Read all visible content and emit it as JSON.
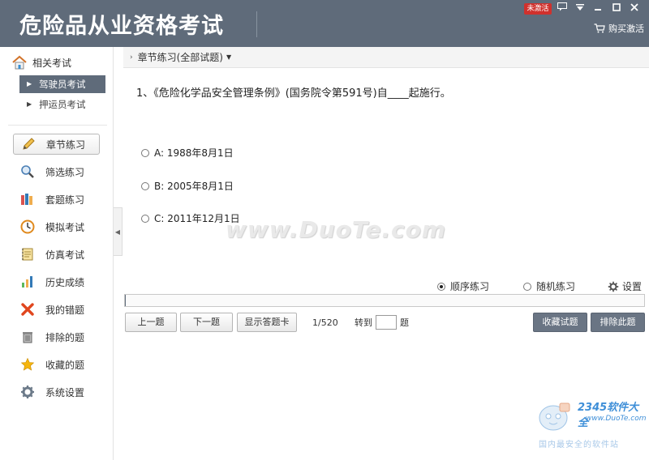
{
  "app": {
    "title": "危险品从业资格考试",
    "badge": "未激活",
    "buy_label": "购买激活"
  },
  "sidebar": {
    "header": "相关考试",
    "sub_items": [
      {
        "label": "驾驶员考试",
        "active": true
      },
      {
        "label": "押运员考试",
        "active": false
      }
    ],
    "nav": [
      {
        "label": "章节练习",
        "icon": "pencil-icon",
        "active": true
      },
      {
        "label": "筛选练习",
        "icon": "magnifier-icon"
      },
      {
        "label": "套题练习",
        "icon": "books-icon"
      },
      {
        "label": "模拟考试",
        "icon": "clock-icon"
      },
      {
        "label": "仿真考试",
        "icon": "notebook-icon"
      },
      {
        "label": "历史成绩",
        "icon": "bar-chart-icon"
      },
      {
        "label": "我的错题",
        "icon": "cross-icon"
      },
      {
        "label": "排除的题",
        "icon": "trash-icon"
      },
      {
        "label": "收藏的题",
        "icon": "star-icon"
      },
      {
        "label": "系统设置",
        "icon": "gear-icon"
      }
    ]
  },
  "main": {
    "breadcrumb": "章节练习(全部试题)",
    "question": "1、《危险化学品安全管理条例》(国务院令第591号)自____起施行。",
    "options": [
      "A: 1988年8月1日",
      "B: 2005年8月1日",
      "C: 2011年12月1日"
    ],
    "mode": {
      "sequential": "顺序练习",
      "random": "随机练习",
      "settings": "设置",
      "selected": "sequential"
    },
    "progress": 0.002,
    "buttons": {
      "prev": "上一题",
      "next": "下一题",
      "show_card": "显示答题卡",
      "favorite": "收藏试题",
      "exclude": "排除此题"
    },
    "counter": "1/520",
    "goto_label": "转到",
    "goto_suffix": "题",
    "goto_value": ""
  },
  "watermarks": {
    "site": "www.DuoTe.com",
    "logo_title": "2345软件大全",
    "logo_url": "www.DuoTe.com",
    "logo_tagline": "国内最安全的软件站"
  },
  "colors": {
    "titlebar": "#5f6b7a",
    "badge": "#d0312d",
    "accent": "#6a7584"
  }
}
